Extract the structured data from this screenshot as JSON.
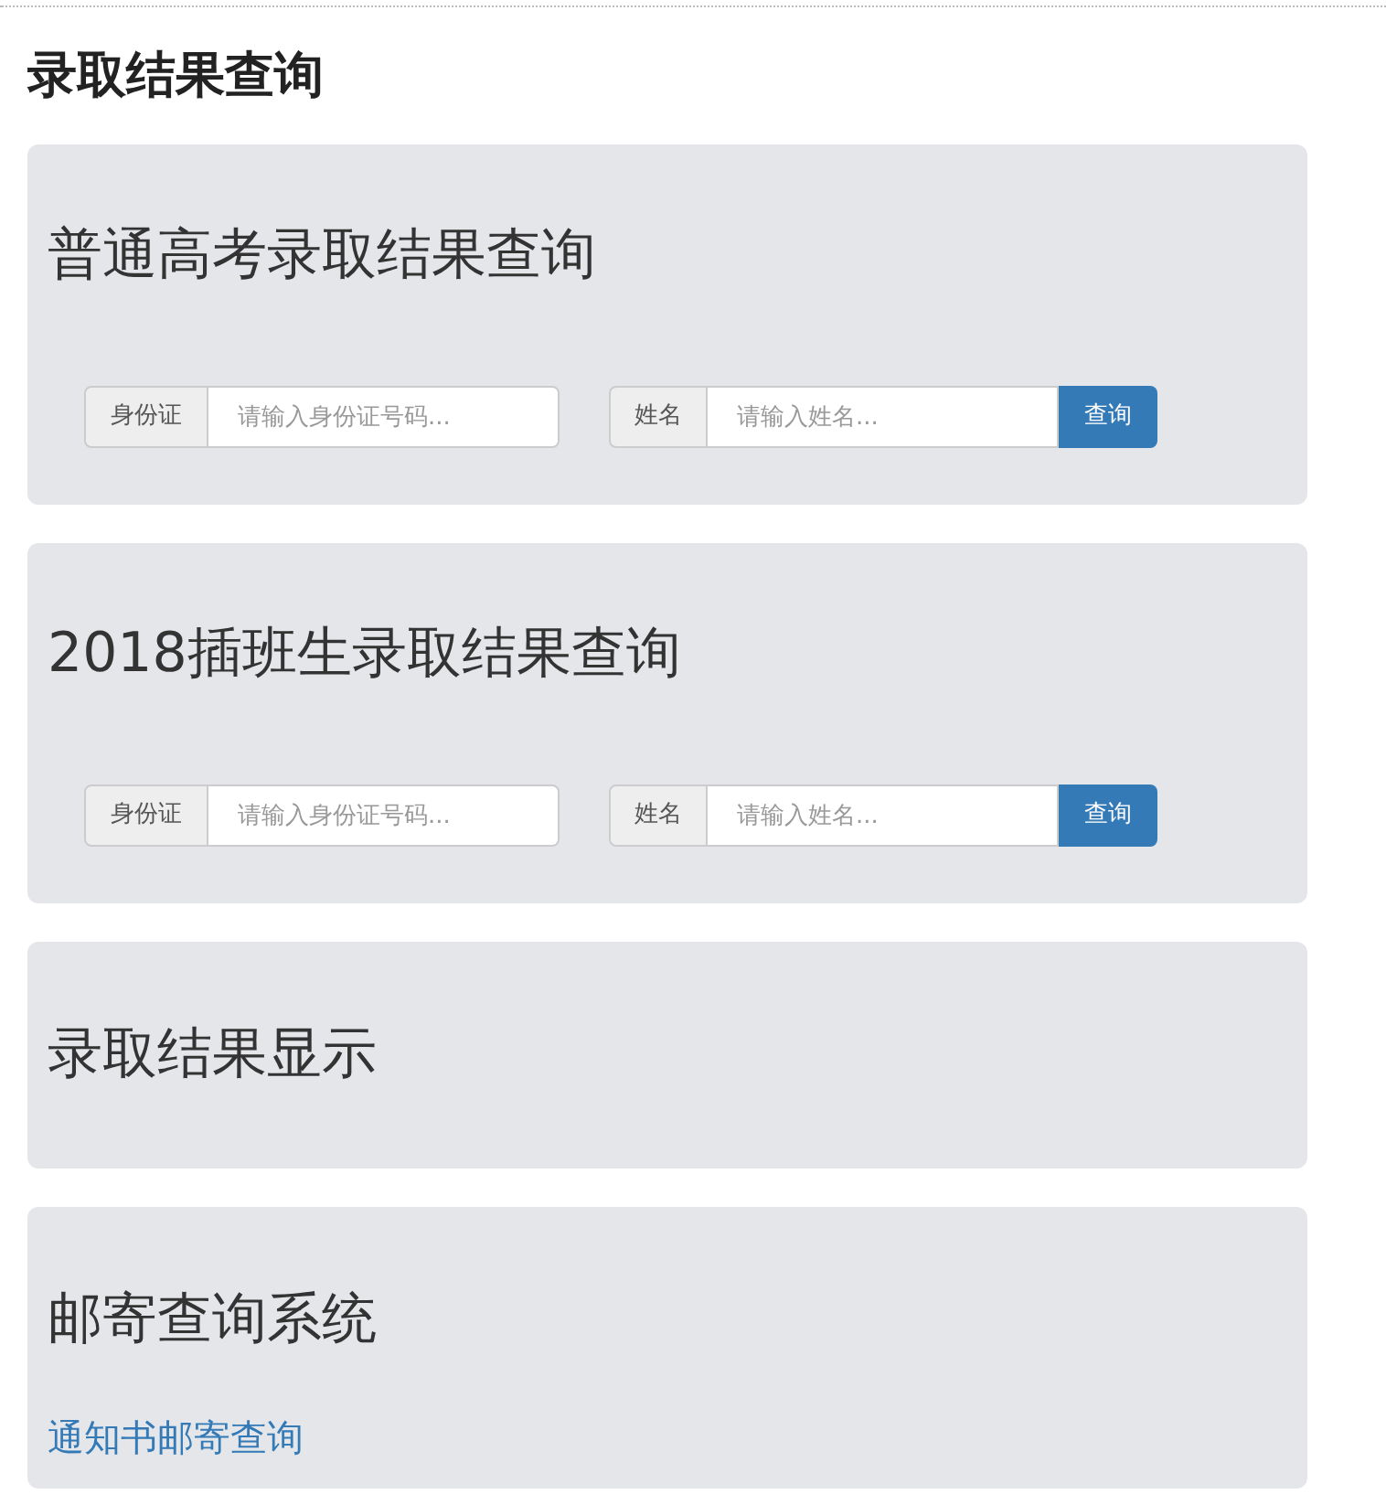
{
  "page_title": "录取结果查询",
  "sections": [
    {
      "kind": "query",
      "heading": "普通高考录取结果查询",
      "id_label": "身份证",
      "id_placeholder": "请输入身份证号码...",
      "name_label": "姓名",
      "name_placeholder": "请输入姓名...",
      "button": "查询"
    },
    {
      "kind": "query",
      "heading": "2018插班生录取结果查询",
      "id_label": "身份证",
      "id_placeholder": "请输入身份证号码...",
      "name_label": "姓名",
      "name_placeholder": "请输入姓名...",
      "button": "查询"
    },
    {
      "kind": "result",
      "heading": "录取结果显示"
    },
    {
      "kind": "mail",
      "heading": "邮寄查询系统",
      "link": "通知书邮寄查询"
    }
  ]
}
